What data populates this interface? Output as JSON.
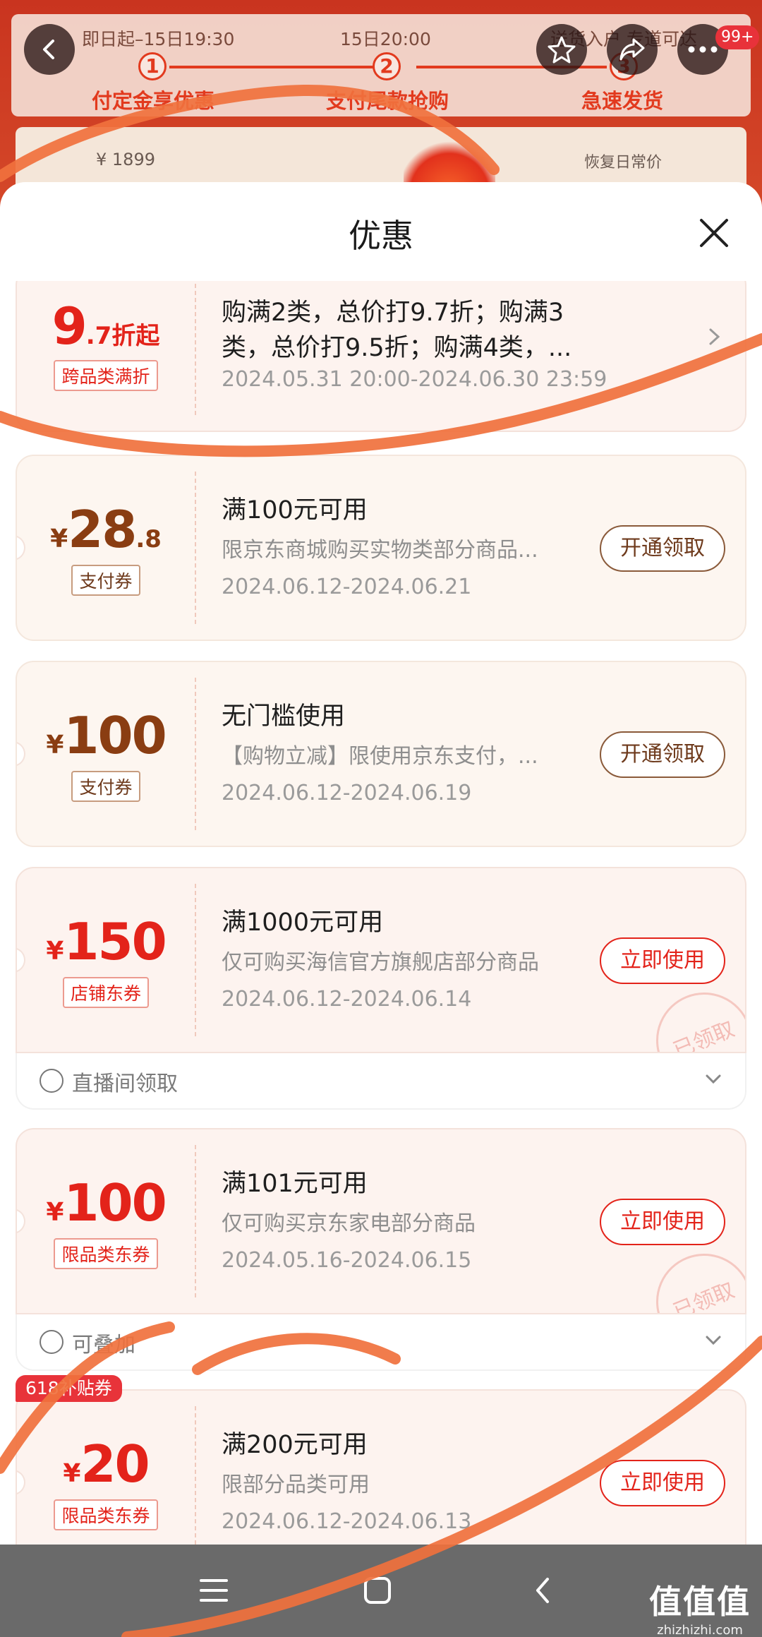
{
  "background": {
    "step1_date": "即日起–15日19:30",
    "step2_date": "15日20:00",
    "step3_date": "送货入户 专道可达",
    "steps": [
      {
        "num": "1",
        "label": "付定金享优惠"
      },
      {
        "num": "2",
        "label": "支付尾款抢购"
      },
      {
        "num": "3",
        "label": "急速发货"
      }
    ],
    "price": "¥ 1899",
    "restore": "恢复日常价",
    "badge": "99+"
  },
  "sheet": {
    "title": "优惠"
  },
  "coupons": [
    {
      "amount_int": "9",
      "amount_dec": ".7折起",
      "tag": "跨品类满折",
      "title_line1": "购满2类，总价打9.7折；购满3",
      "title_line2": "类，总价打9.5折；购满4类，...",
      "date": "2024.05.31 20:00-2024.06.30 23:59"
    },
    {
      "currency": "¥",
      "amount_int": "28",
      "amount_dec": ".8",
      "tag": "支付券",
      "title": "满100元可用",
      "desc": "限京东商城购买实物类部分商品...",
      "date": "2024.06.12-2024.06.21",
      "action": "开通领取"
    },
    {
      "currency": "¥",
      "amount_int": "100",
      "tag": "支付券",
      "title": "无门槛使用",
      "desc": "【购物立减】限使用京东支付，...",
      "date": "2024.06.12-2024.06.19",
      "action": "开通领取"
    },
    {
      "currency": "¥",
      "amount_int": "150",
      "tag": "店铺东券",
      "title": "满1000元可用",
      "desc": "仅可购买海信官方旗舰店部分商品",
      "date": "2024.06.12-2024.06.14",
      "action": "立即使用",
      "stamp": "已领取",
      "footer": "直播间领取"
    },
    {
      "currency": "¥",
      "amount_int": "100",
      "tag": "限品类东券",
      "title": "满101元可用",
      "desc": "仅可购买京东家电部分商品",
      "date": "2024.05.16-2024.06.15",
      "action": "立即使用",
      "stamp": "已领取",
      "footer": "可叠加"
    },
    {
      "corner": "618补贴券",
      "currency": "¥",
      "amount_int": "20",
      "tag": "限品类东券",
      "title": "满200元可用",
      "desc": "限部分品类可用",
      "date": "2024.06.12-2024.06.13",
      "action": "立即使用"
    }
  ],
  "watermark": {
    "big": "值值值",
    "small": "zhizhizhi.com"
  },
  "colors": {
    "accent_red": "#e3231a",
    "brown": "#8a3d12",
    "scribble": "#f0713d"
  }
}
